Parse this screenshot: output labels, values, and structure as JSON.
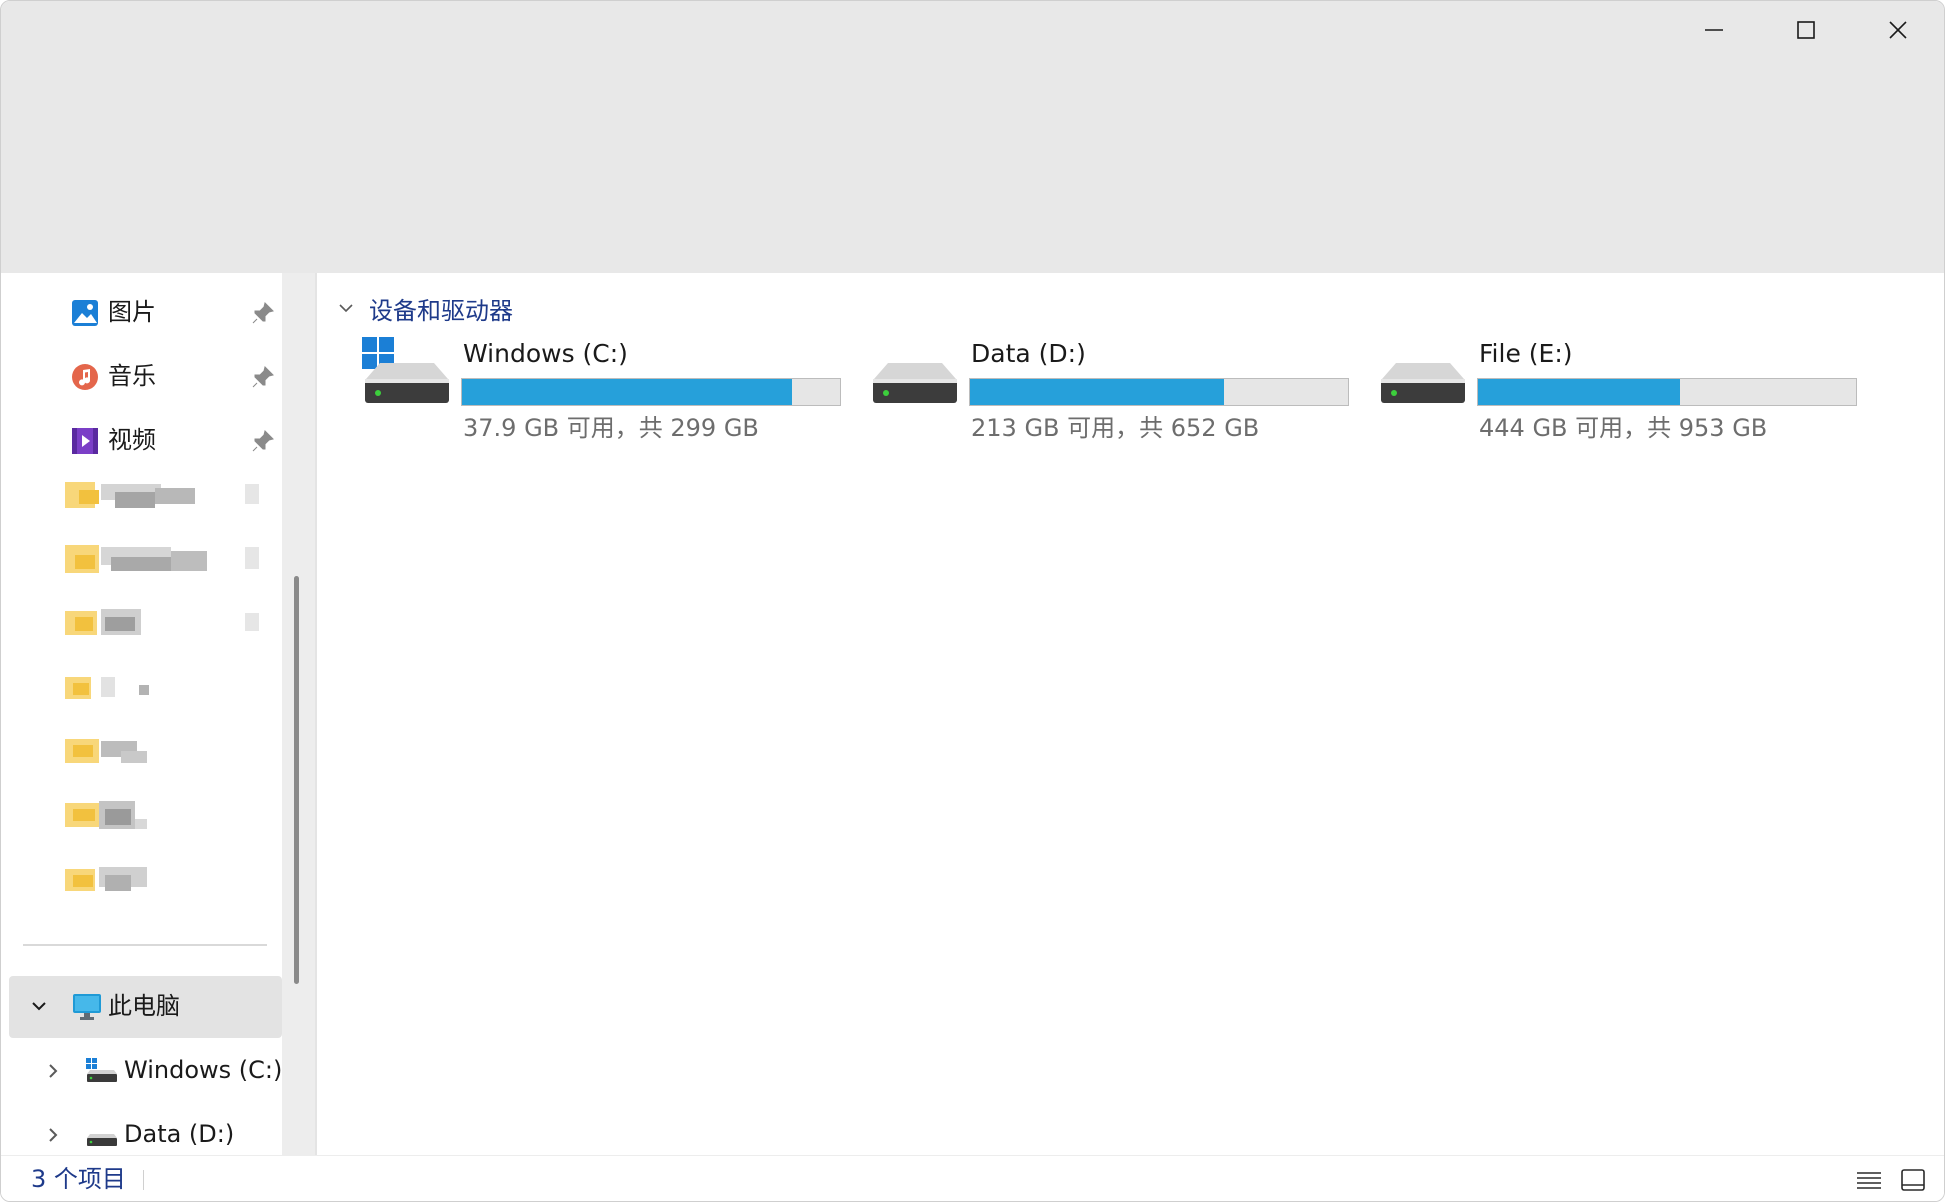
{
  "window": {
    "controls": {
      "minimize": "minimize-icon",
      "maximize": "maximize-icon",
      "close": "close-icon"
    }
  },
  "sidebar": {
    "quick_access": [
      {
        "label": "图片",
        "icon": "pictures-icon",
        "pinned": true
      },
      {
        "label": "音乐",
        "icon": "music-icon",
        "pinned": true
      },
      {
        "label": "视频",
        "icon": "videos-icon",
        "pinned": true
      }
    ],
    "tree": {
      "this_pc": {
        "label": "此电脑",
        "expanded": true
      },
      "drives": [
        {
          "label": "Windows (C:)"
        },
        {
          "label": "Data (D:)"
        }
      ]
    }
  },
  "content": {
    "group_title": "设备和驱动器",
    "drives": [
      {
        "name": "Windows (C:)",
        "size_text": "37.9 GB 可用，共 299 GB",
        "used_fraction": 0.873,
        "system": true
      },
      {
        "name": "Data (D:)",
        "size_text": "213 GB 可用，共 652 GB",
        "used_fraction": 0.673,
        "system": false
      },
      {
        "name": "File (E:)",
        "size_text": "444 GB 可用，共 953 GB",
        "used_fraction": 0.534,
        "system": false
      }
    ]
  },
  "status_bar": {
    "item_count": "3 个项目"
  },
  "colors": {
    "accent_bar": "#26a0da",
    "link_blue": "#1e3a8a",
    "selected_bg": "#e3e3e3"
  }
}
